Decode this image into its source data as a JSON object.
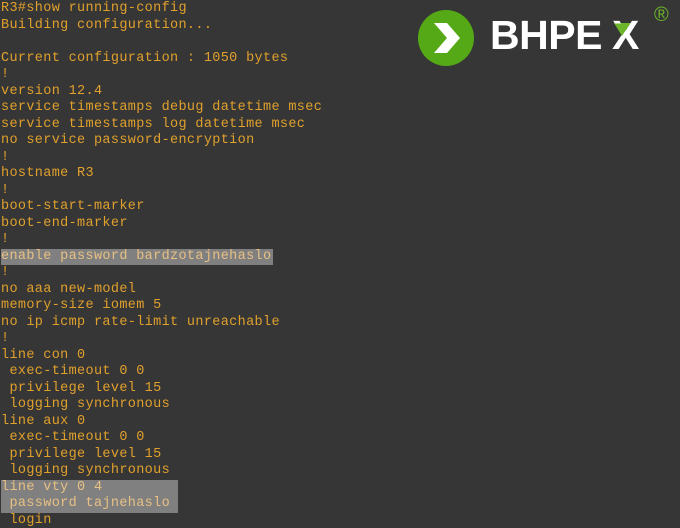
{
  "theme": {
    "terminal_background": "#363636",
    "terminal_text": "#e0a02c",
    "selection_background": "#808080",
    "selection_text": "#e8c083",
    "brand_green": "#55a916",
    "logo_text": "#ffffff"
  },
  "brand": {
    "name": "BHPEX",
    "registered_mark": "®",
    "mark_icon": "chevron-right-in-circle"
  },
  "terminal": {
    "prompt": "R3#",
    "command": "show running-config",
    "lines": [
      {
        "text": "R3#show running-config",
        "highlight": "none"
      },
      {
        "text": "Building configuration...",
        "highlight": "none"
      },
      {
        "text": "",
        "highlight": "none"
      },
      {
        "text": "Current configuration : 1050 bytes",
        "highlight": "none"
      },
      {
        "text": "!",
        "highlight": "none"
      },
      {
        "text": "version 12.4",
        "highlight": "none"
      },
      {
        "text": "service timestamps debug datetime msec",
        "highlight": "none"
      },
      {
        "text": "service timestamps log datetime msec",
        "highlight": "none"
      },
      {
        "text": "no service password-encryption",
        "highlight": "none"
      },
      {
        "text": "!",
        "highlight": "none"
      },
      {
        "text": "hostname R3",
        "highlight": "none"
      },
      {
        "text": "!",
        "highlight": "none"
      },
      {
        "text": "boot-start-marker",
        "highlight": "none"
      },
      {
        "text": "boot-end-marker",
        "highlight": "none"
      },
      {
        "text": "!",
        "highlight": "none"
      },
      {
        "text": "enable password bardzotajnehaslo",
        "highlight": "inline"
      },
      {
        "text": "!",
        "highlight": "none"
      },
      {
        "text": "no aaa new-model",
        "highlight": "none"
      },
      {
        "text": "memory-size iomem 5",
        "highlight": "none"
      },
      {
        "text": "no ip icmp rate-limit unreachable",
        "highlight": "none"
      },
      {
        "text": "!",
        "highlight": "none"
      },
      {
        "text": "line con 0",
        "highlight": "none"
      },
      {
        "text": " exec-timeout 0 0",
        "highlight": "none"
      },
      {
        "text": " privilege level 15",
        "highlight": "none"
      },
      {
        "text": " logging synchronous",
        "highlight": "none"
      },
      {
        "text": "line aux 0",
        "highlight": "none"
      },
      {
        "text": " exec-timeout 0 0",
        "highlight": "none"
      },
      {
        "text": " privilege level 15",
        "highlight": "none"
      },
      {
        "text": " logging synchronous",
        "highlight": "none"
      },
      {
        "text": "line vty 0 4",
        "highlight": "block"
      },
      {
        "text": " password tajnehaslo",
        "highlight": "block"
      },
      {
        "text": " login",
        "highlight": "none"
      }
    ],
    "selected_text": [
      "enable password bardzotajnehaslo",
      "line vty 0 4",
      " password tajnehaslo"
    ]
  }
}
